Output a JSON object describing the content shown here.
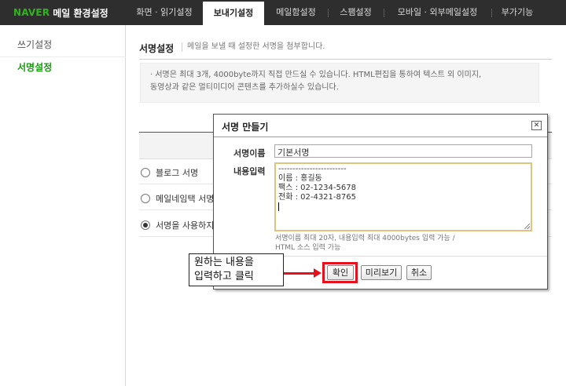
{
  "brand": {
    "logo": "NAVER",
    "title": "메일 환경설정"
  },
  "nav": [
    {
      "label": "화면 · 읽기설정",
      "active": false
    },
    {
      "label": "보내기설정",
      "active": true
    },
    {
      "label": "메일함설정",
      "active": false
    },
    {
      "label": "스팸설정",
      "active": false
    },
    {
      "label": "모바일 · 외부메일설정",
      "active": false
    },
    {
      "label": "부가기능",
      "active": false
    }
  ],
  "sidebar": {
    "items": [
      {
        "label": "쓰기설정",
        "active": false
      },
      {
        "label": "서명설정",
        "active": true
      }
    ]
  },
  "main": {
    "title": "서명설정",
    "description": "메일을 보낼 때 설정한 서명을 첨부합니다.",
    "info_line1": "· 서명은 최대 3개, 4000byte까지 직접 만드실 수 있습니다. HTML편집을 통하여 텍스트 외 이미지,",
    "info_line2": "  동영상과 같은 멀티미디어 콘텐츠를 추가하실수 있습니다.",
    "options": [
      {
        "label": "블로그 서명",
        "selected": false
      },
      {
        "label": "메일네임택 서명",
        "selected": false
      },
      {
        "label": "서명을 사용하지",
        "selected": true
      }
    ]
  },
  "modal": {
    "title": "서명 만들기",
    "close_glyph": "✕",
    "name_label": "서명이름",
    "name_value": "기본서명",
    "content_label": "내용입력",
    "content_lines": [
      "------------------------",
      "이름 : 홍길동",
      "팩스 : 02-1234-5678",
      "전화 : 02-4321-8765"
    ],
    "hint_line1": "서명이름 최대 20자, 내용입력 최대 4000bytes 입력 가능 /",
    "hint_line2": "HTML 소스 입력 가능",
    "buttons": {
      "confirm": "확인",
      "preview": "미리보기",
      "cancel": "취소"
    }
  },
  "annotation": {
    "line1": "원하는 내용을",
    "line2": "입력하고 클릭",
    "color": "#e8101c"
  },
  "colors": {
    "brand_green": "#2fb51c",
    "topbar": "#2e2e2e",
    "active_side": "#1a9a12"
  }
}
